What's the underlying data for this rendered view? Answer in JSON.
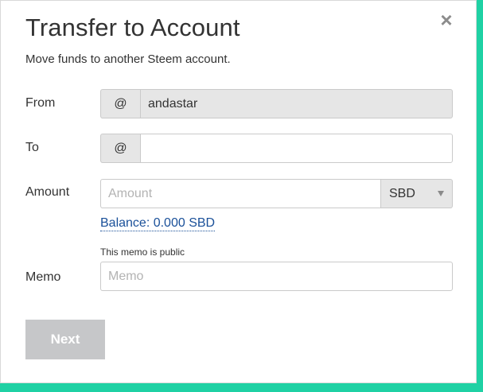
{
  "dialog": {
    "title": "Transfer to Account",
    "subtitle": "Move funds to another Steem account.",
    "close_glyph": "×"
  },
  "form": {
    "from": {
      "label": "From",
      "prefix": "@",
      "value": "andastar"
    },
    "to": {
      "label": "To",
      "prefix": "@",
      "value": ""
    },
    "amount": {
      "label": "Amount",
      "placeholder": "Amount",
      "currency_selected": "SBD",
      "balance_text": "Balance: 0.000 SBD"
    },
    "memo": {
      "label": "Memo",
      "hint": "This memo is public",
      "placeholder": "Memo"
    }
  },
  "actions": {
    "next_label": "Next"
  },
  "colors": {
    "accent_border": "#1fd1a4",
    "link": "#1a5099",
    "disabled_button": "#c6c7c9"
  }
}
